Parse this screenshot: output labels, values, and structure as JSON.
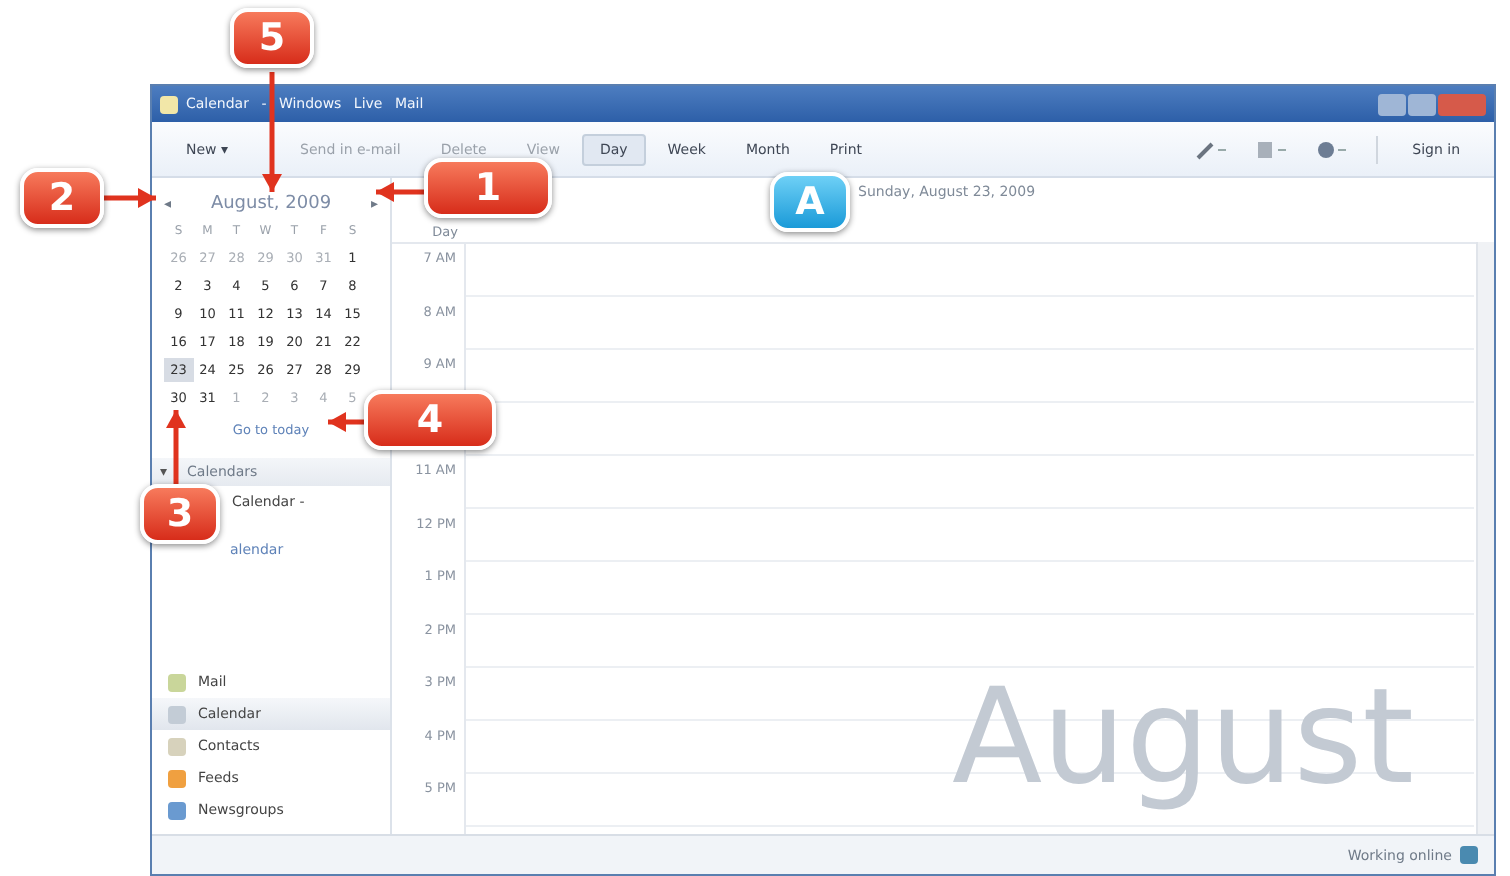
{
  "window": {
    "title": "Calendar - Windows Live Mail"
  },
  "toolbar": {
    "left": [
      {
        "label": "New",
        "dropdown": true,
        "disabled": false,
        "selected": false
      },
      {
        "label": "Send in e-mail",
        "dropdown": false,
        "disabled": true,
        "selected": false
      },
      {
        "label": "Delete",
        "dropdown": false,
        "disabled": true,
        "selected": false
      },
      {
        "label": "View",
        "dropdown": false,
        "disabled": true,
        "selected": false
      },
      {
        "label": "Day",
        "dropdown": false,
        "disabled": false,
        "selected": true
      },
      {
        "label": "Week",
        "dropdown": false,
        "disabled": false,
        "selected": false
      },
      {
        "label": "Month",
        "dropdown": false,
        "disabled": false,
        "selected": false
      },
      {
        "label": "Print",
        "dropdown": false,
        "disabled": false,
        "selected": false
      }
    ],
    "right": [
      {
        "kind": "pen"
      },
      {
        "kind": "tools"
      },
      {
        "kind": "globe"
      }
    ],
    "sign_in": "Sign in",
    "dropdown_mark": "▾"
  },
  "mini_calendar": {
    "month": "August, 2009",
    "prev": "◂",
    "next": "▸",
    "weekdays": [
      "S",
      "M",
      "T",
      "W",
      "T",
      "F",
      "S"
    ],
    "weeks": [
      [
        {
          "d": "26",
          "other": true,
          "selected": false
        },
        {
          "d": "27",
          "other": true,
          "selected": false
        },
        {
          "d": "28",
          "other": true,
          "selected": false
        },
        {
          "d": "29",
          "other": true,
          "selected": false
        },
        {
          "d": "30",
          "other": true,
          "selected": false
        },
        {
          "d": "31",
          "other": true,
          "selected": false
        },
        {
          "d": "1",
          "other": false,
          "selected": false
        }
      ],
      [
        {
          "d": "2",
          "other": false,
          "selected": false
        },
        {
          "d": "3",
          "other": false,
          "selected": false
        },
        {
          "d": "4",
          "other": false,
          "selected": false
        },
        {
          "d": "5",
          "other": false,
          "selected": false
        },
        {
          "d": "6",
          "other": false,
          "selected": false
        },
        {
          "d": "7",
          "other": false,
          "selected": false
        },
        {
          "d": "8",
          "other": false,
          "selected": false
        }
      ],
      [
        {
          "d": "9",
          "other": false,
          "selected": false
        },
        {
          "d": "10",
          "other": false,
          "selected": false
        },
        {
          "d": "11",
          "other": false,
          "selected": false
        },
        {
          "d": "12",
          "other": false,
          "selected": false
        },
        {
          "d": "13",
          "other": false,
          "selected": false
        },
        {
          "d": "14",
          "other": false,
          "selected": false
        },
        {
          "d": "15",
          "other": false,
          "selected": false
        }
      ],
      [
        {
          "d": "16",
          "other": false,
          "selected": false
        },
        {
          "d": "17",
          "other": false,
          "selected": false
        },
        {
          "d": "18",
          "other": false,
          "selected": false
        },
        {
          "d": "19",
          "other": false,
          "selected": false
        },
        {
          "d": "20",
          "other": false,
          "selected": false
        },
        {
          "d": "21",
          "other": false,
          "selected": false
        },
        {
          "d": "22",
          "other": false,
          "selected": false
        }
      ],
      [
        {
          "d": "23",
          "other": false,
          "selected": true
        },
        {
          "d": "24",
          "other": false,
          "selected": false
        },
        {
          "d": "25",
          "other": false,
          "selected": false
        },
        {
          "d": "26",
          "other": false,
          "selected": false
        },
        {
          "d": "27",
          "other": false,
          "selected": false
        },
        {
          "d": "28",
          "other": false,
          "selected": false
        },
        {
          "d": "29",
          "other": false,
          "selected": false
        }
      ],
      [
        {
          "d": "30",
          "other": false,
          "selected": false
        },
        {
          "d": "31",
          "other": false,
          "selected": false
        },
        {
          "d": "1",
          "other": true,
          "selected": false
        },
        {
          "d": "2",
          "other": true,
          "selected": false
        },
        {
          "d": "3",
          "other": true,
          "selected": false
        },
        {
          "d": "4",
          "other": true,
          "selected": false
        },
        {
          "d": "5",
          "other": true,
          "selected": false
        }
      ]
    ],
    "go_to_today": "Go to today"
  },
  "calendars": {
    "header": "Calendars",
    "arrow": "▾",
    "expanded": true,
    "items": [
      "Calendar -"
    ],
    "add_link": "alendar"
  },
  "nav": [
    {
      "label": "Mail",
      "kind": "mail",
      "selected": false
    },
    {
      "label": "Calendar",
      "kind": "calendar",
      "selected": true
    },
    {
      "label": "Contacts",
      "kind": "contacts",
      "selected": false
    },
    {
      "label": "Feeds",
      "kind": "feeds",
      "selected": false
    },
    {
      "label": "Newsgroups",
      "kind": "newsgroups",
      "selected": false
    }
  ],
  "day_view": {
    "date": "Sunday, August 23, 2009",
    "day_label": "Day",
    "hours_top": [
      "7 AM",
      "8 AM",
      "9 AM"
    ],
    "hours_bottom": [
      "11 AM",
      "12 PM",
      "1 PM",
      "2 PM",
      "3 PM",
      "4 PM",
      "5 PM"
    ],
    "watermark": "August"
  },
  "status_bar": {
    "text": "Working online"
  },
  "callouts": [
    {
      "label": "5",
      "kind": "step"
    },
    {
      "label": "2",
      "kind": "step"
    },
    {
      "label": "1",
      "kind": "step"
    },
    {
      "label": "3",
      "kind": "step"
    },
    {
      "label": "4",
      "kind": "step"
    },
    {
      "label": "A",
      "kind": "info"
    }
  ]
}
